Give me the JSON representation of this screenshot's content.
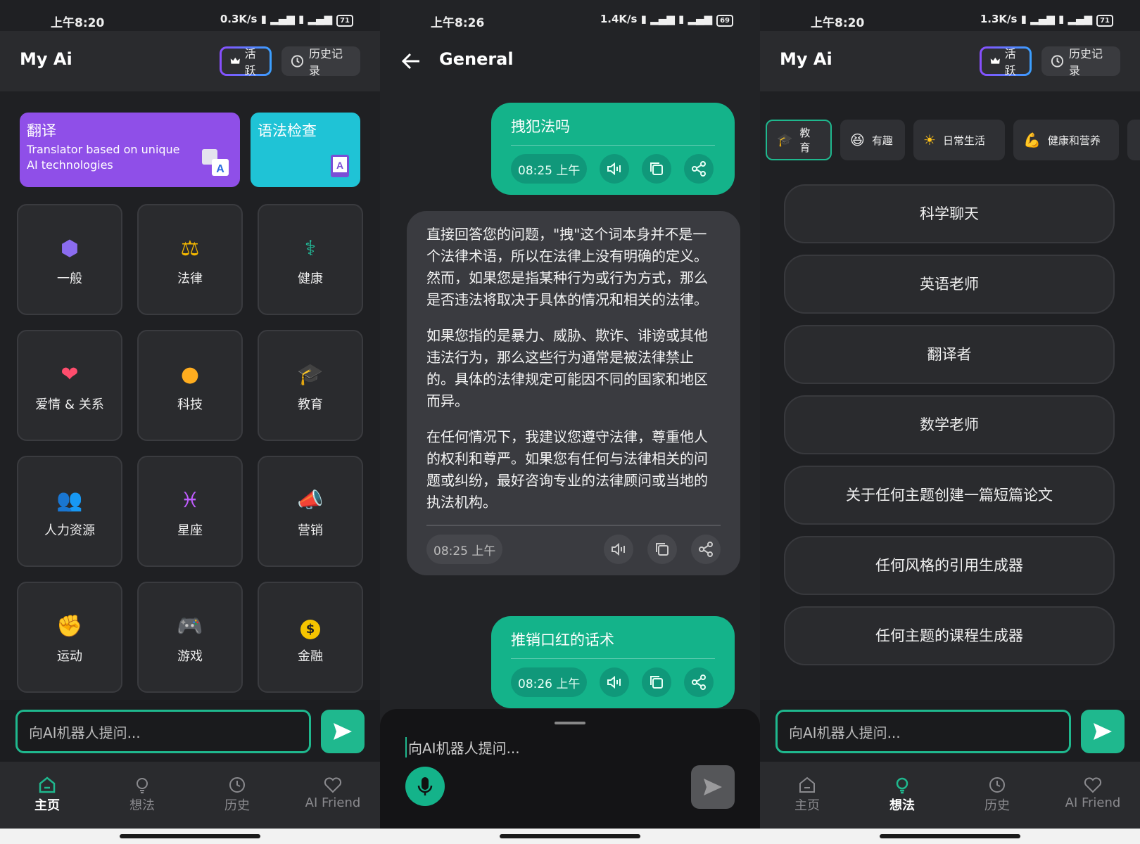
{
  "status_left": {
    "time": "上午8:20",
    "speed": "0.3K/s",
    "battery": "71"
  },
  "status_mid": {
    "time": "上午8:26",
    "speed": "1.4K/s",
    "battery": "69"
  },
  "status_right": {
    "time": "上午8:20",
    "speed": "1.3K/s",
    "battery": "71"
  },
  "app_title": "My Ai",
  "header": {
    "active_label": "活跃",
    "history_label": "历史记录"
  },
  "banners": {
    "translate": {
      "title": "翻译",
      "desc": "Translator based on unique AI technologies"
    },
    "grammar": {
      "title": "语法检查"
    }
  },
  "categories": [
    {
      "label": "一般",
      "icon": "hexagons-icon"
    },
    {
      "label": "法律",
      "icon": "scales-icon"
    },
    {
      "label": "健康",
      "icon": "doctor-icon"
    },
    {
      "label": "爱情 & 关系",
      "icon": "hearts-icon"
    },
    {
      "label": "科技",
      "icon": "bulb-icon"
    },
    {
      "label": "教育",
      "icon": "graduation-cap-icon"
    },
    {
      "label": "人力资源",
      "icon": "people-icon"
    },
    {
      "label": "星座",
      "icon": "pisces-icon"
    },
    {
      "label": "营销",
      "icon": "megaphone-icon"
    },
    {
      "label": "运动",
      "icon": "muscle-icon"
    },
    {
      "label": "游戏",
      "icon": "gamepad-icon"
    },
    {
      "label": "金融",
      "icon": "dollar-coin-icon"
    }
  ],
  "ask_placeholder": "向AI机器人提问...",
  "nav": {
    "home": "主页",
    "ideas": "想法",
    "history": "历史",
    "friend": "AI Friend"
  },
  "chat": {
    "title": "General",
    "user_msg1": "拽犯法吗",
    "user_time1": "08:25 上午",
    "ai_p1": "直接回答您的问题，\"拽\"这个词本身并不是一个法律术语，所以在法律上没有明确的定义。然而，如果您是指某种行为或行为方式，那么是否违法将取决于具体的情况和相关的法律。",
    "ai_p2": "如果您指的是暴力、威胁、欺诈、诽谤或其他违法行为，那么这些行为通常是被法律禁止的。具体的法律规定可能因不同的国家和地区而异。",
    "ai_p3": "在任何情况下，我建议您遵守法律，尊重他人的权利和尊严。如果您有任何与法律相关的问题或纠纷，最好咨询专业的法律顾问或当地的执法机构。",
    "ai_time": "08:25 上午",
    "user_msg2": "推销口红的话术",
    "user_time2": "08:26 上午"
  },
  "idea_chips": [
    {
      "label": "教育",
      "icon": "graduation-cap-icon"
    },
    {
      "label": "有趣",
      "icon": "laughing-face-icon"
    },
    {
      "label": "日常生活",
      "icon": "sun-icon"
    },
    {
      "label": "健康和营养",
      "icon": "muscle-icon"
    }
  ],
  "prompts": [
    "科学聊天",
    "英语老师",
    "翻译者",
    "数学老师",
    "关于任何主题创建一篇短篇论文",
    "任何风格的引用生成器",
    "任何主题的课程生成器"
  ],
  "colors": {
    "accent": "#1fb88e",
    "translate_banner": "#8f4fe8",
    "grammar_banner": "#1fc3d6"
  }
}
